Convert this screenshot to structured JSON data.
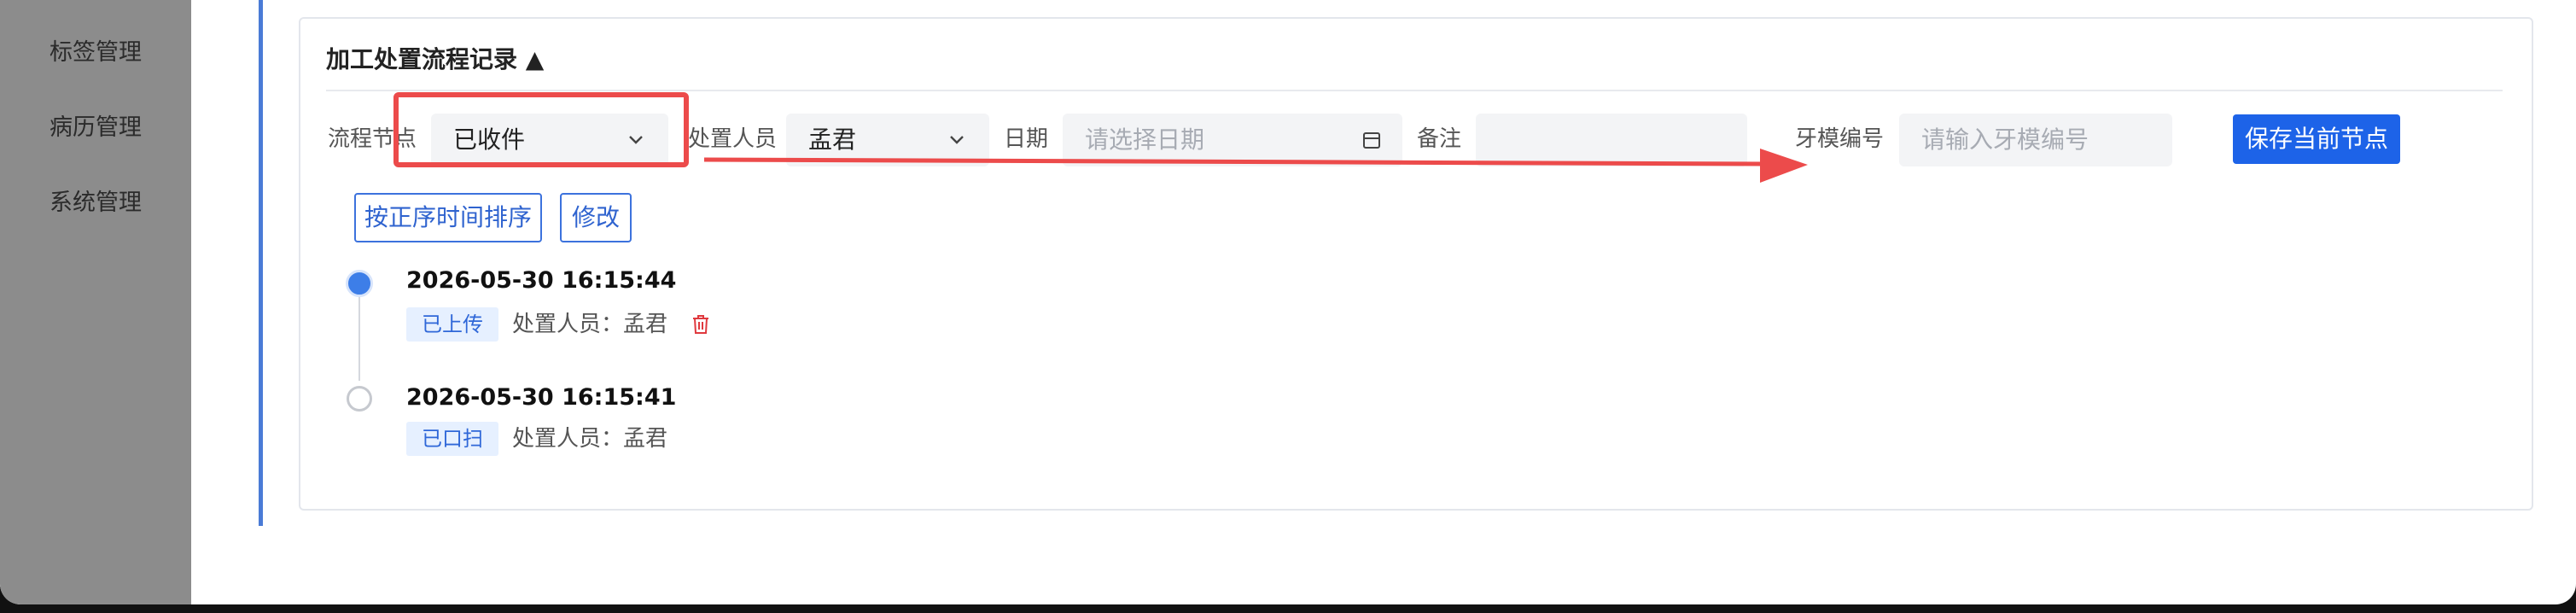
{
  "sidebar": {
    "items": [
      {
        "label": "标签管理"
      },
      {
        "label": "病历管理"
      },
      {
        "label": "系统管理"
      }
    ]
  },
  "section": {
    "title": "加工处置流程记录 ▲"
  },
  "form": {
    "node_label": "流程节点",
    "node_value": "已收件",
    "operator_label": "处置人员",
    "operator_value": "孟君",
    "date_label": "日期",
    "date_placeholder": "请选择日期",
    "note_label": "备注",
    "note_value": "",
    "mold_label": "牙模编号",
    "mold_placeholder": "请输入牙模编号",
    "save_button": "保存当前节点"
  },
  "actions": {
    "sort_button": "按正序时间排序",
    "edit_button": "修改"
  },
  "timeline": [
    {
      "time": "2026-05-30 16:15:44",
      "status": "已上传",
      "operator_text": "处置人员：孟君",
      "active": true
    },
    {
      "time": "2026-05-30 16:15:41",
      "status": "已口扫",
      "operator_text": "处置人员：孟君",
      "active": false
    }
  ],
  "colors": {
    "primary": "#1d63e8",
    "annotation": "#ec4b4b",
    "tag_bg": "#e6f0ff",
    "delete": "#e0393e"
  }
}
